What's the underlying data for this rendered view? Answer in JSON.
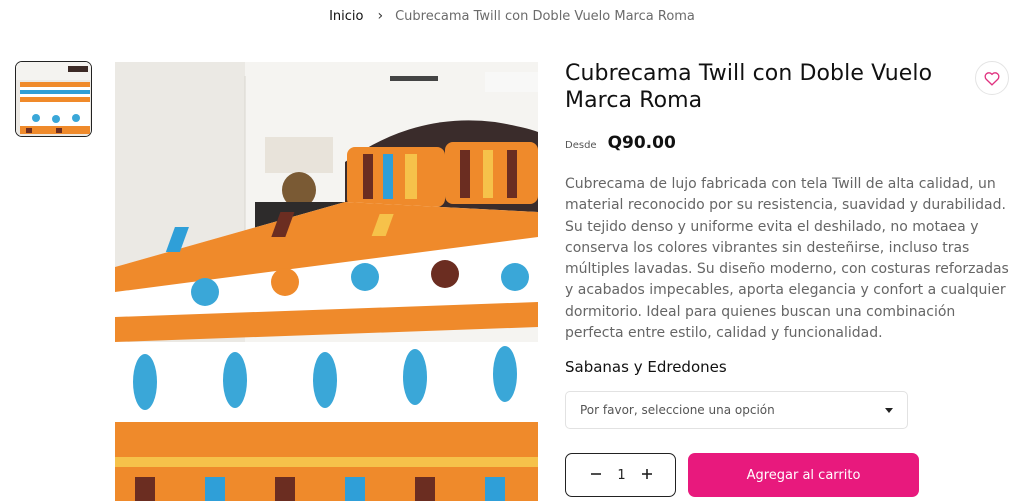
{
  "breadcrumb": {
    "home": "Inicio",
    "separator": "›",
    "current": "Cubrecama Twill con Doble Vuelo Marca Roma"
  },
  "product": {
    "title": "Cubrecama Twill con Doble Vuelo Marca Roma",
    "price_prefix": "Desde",
    "price": "Q90.00",
    "description": "Cubrecama de lujo fabricada con tela Twill de alta calidad, un material reconocido por su resistencia, suavidad y durabilidad. Su tejido denso y uniforme evita el deshilado, no motaea y conserva los colores vibrantes sin desteñirse, incluso tras múltiples lavadas. Su diseño moderno, con costuras reforzadas y acabados impecables, aporta elegancia y confort a cualquier dormitorio. Ideal para quienes buscan una combinación perfecta entre estilo, calidad y funcionalidad.",
    "variant_label": "Sabanas y Edredones",
    "variant_placeholder": "Por favor, seleccione una opción",
    "quantity": "1",
    "add_to_cart": "Agregar al carrito"
  },
  "icons": {
    "wishlist": "heart-icon",
    "dropdown": "caret-down-icon",
    "decrease": "minus-icon",
    "increase": "plus-icon"
  },
  "colors": {
    "accent": "#e8197d",
    "heart": "#e0317f",
    "text": "#111111",
    "muted": "#666666"
  }
}
